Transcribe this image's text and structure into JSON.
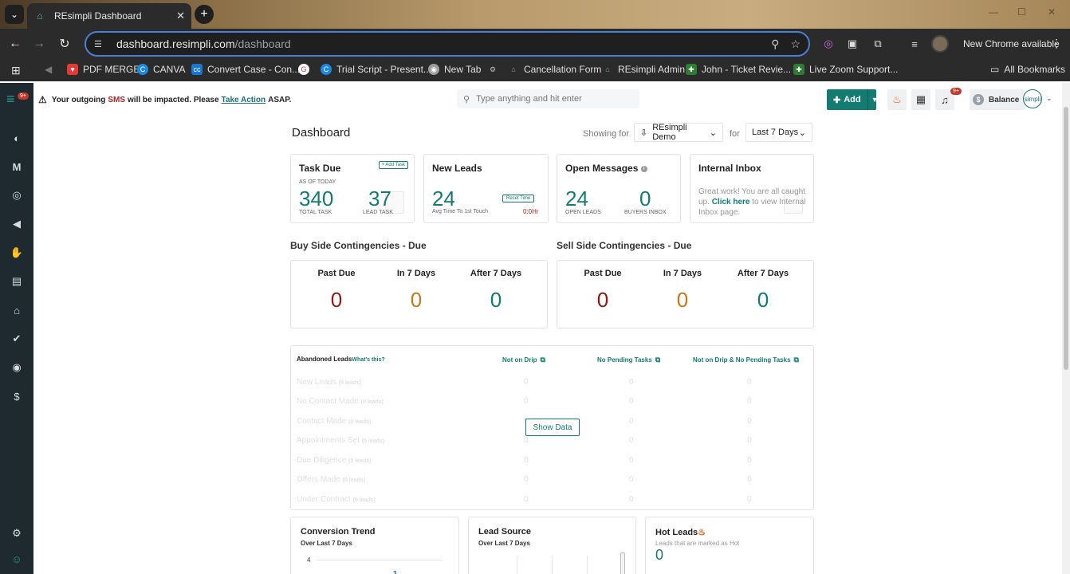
{
  "browser": {
    "tab_title": "REsimpli Dashboard",
    "url_host": "dashboard.resimpli.com",
    "url_path": "/dashboard",
    "update_label": "New Chrome available",
    "bookmarks": [
      {
        "label": "PDF MERGE",
        "color": "#e53935"
      },
      {
        "label": "CANVA",
        "color": "#1e88e5"
      },
      {
        "label": "Convert Case - Con...",
        "color": "#1976d2"
      },
      {
        "label": "",
        "color": "#ffffff"
      },
      {
        "label": "Trial Script - Present...",
        "color": "#1e88e5"
      },
      {
        "label": "New Tab",
        "color": "#9e9e9e"
      },
      {
        "label": "",
        "color": "#9e9e9e"
      },
      {
        "label": "Cancellation Form",
        "color": "#6fb3ad"
      },
      {
        "label": "REsimpli Admin",
        "color": "#6fb3ad"
      },
      {
        "label": "John - Ticket Revie...",
        "color": "#2e7d32"
      },
      {
        "label": "Live Zoom Support...",
        "color": "#2e7d32"
      }
    ],
    "all_bookmarks": "All Bookmarks"
  },
  "sidebar": {
    "badge": "9+"
  },
  "topbar": {
    "alert_prefix": "Your outgoing",
    "alert_sms": "SMS",
    "alert_mid": "will be impacted. Please",
    "alert_link": "Take Action",
    "alert_suffix": "ASAP.",
    "search_placeholder": "Type anything and hit enter",
    "add_label": "Add",
    "notif_badge": "9+",
    "balance_label": "Balance",
    "avatar_text": "simpli"
  },
  "dashboard": {
    "title": "Dashboard",
    "showing_label": "Showing for",
    "account": "REsimpli Demo",
    "for_label": "for",
    "period": "Last 7 Days"
  },
  "task_due": {
    "title": "Task Due",
    "add_task": "+ Add Task",
    "as_of": "AS OF TODAY",
    "total": "340",
    "total_label": "TOTAL TASK",
    "lead": "37",
    "lead_label": "LEAD TASK"
  },
  "new_leads": {
    "title": "New Leads",
    "value": "24",
    "sub": "Avg Time To 1st Touch",
    "reset": "Reset Time",
    "time": "0:0Hr"
  },
  "open_messages": {
    "title": "Open Messages",
    "open_leads": "24",
    "open_leads_label": "OPEN LEADS",
    "buyers": "0",
    "buyers_label": "BUYERS INBOX"
  },
  "internal_inbox": {
    "title": "Internal Inbox",
    "text1": "Great work! You are all caught up.",
    "link": "Click here",
    "text2": "to view Internal Inbox page."
  },
  "buy_side": {
    "title": "Buy Side Contingencies - Due",
    "cols": [
      {
        "label": "Past Due",
        "value": "0"
      },
      {
        "label": "In 7 Days",
        "value": "0"
      },
      {
        "label": "After 7 Days",
        "value": "0"
      }
    ]
  },
  "sell_side": {
    "title": "Sell Side Contingencies - Due",
    "cols": [
      {
        "label": "Past Due",
        "value": "0"
      },
      {
        "label": "In 7 Days",
        "value": "0"
      },
      {
        "label": "After 7 Days",
        "value": "0"
      }
    ]
  },
  "abandoned": {
    "title": "Abandoned Leads",
    "whats_this": "What's this?",
    "headers": [
      "Not on Drip",
      "No Pending Tasks",
      "Not on Drip & No Pending Tasks"
    ],
    "show_data": "Show Data",
    "rows": [
      {
        "name": "New Leads",
        "count": "(0 leads)",
        "a": "0",
        "b": "0",
        "c": "0"
      },
      {
        "name": "No Contact Made",
        "count": "(0 leads)",
        "a": "0",
        "b": "0",
        "c": "0"
      },
      {
        "name": "Contact Made",
        "count": "(0 leads)",
        "a": "0",
        "b": "0",
        "c": "0"
      },
      {
        "name": "Appointments Set",
        "count": "(0 leads)",
        "a": "0",
        "b": "0",
        "c": "0"
      },
      {
        "name": "Due Diligence",
        "count": "(0 leads)",
        "a": "0",
        "b": "0",
        "c": "0"
      },
      {
        "name": "Offers Made",
        "count": "(0 leads)",
        "a": "0",
        "b": "0",
        "c": "0"
      },
      {
        "name": "Under Contract",
        "count": "(0 leads)",
        "a": "0",
        "b": "0",
        "c": "0"
      }
    ]
  },
  "conversion": {
    "title": "Conversion Trend",
    "sub": "Over Last 7 Days",
    "axis_tick": "4",
    "point_label": "3"
  },
  "lead_source": {
    "title": "Lead Source",
    "sub": "Over Last 7 Days"
  },
  "hot_leads": {
    "title": "Hot Leads",
    "sub": "Leads that are marked as Hot",
    "value": "0"
  }
}
